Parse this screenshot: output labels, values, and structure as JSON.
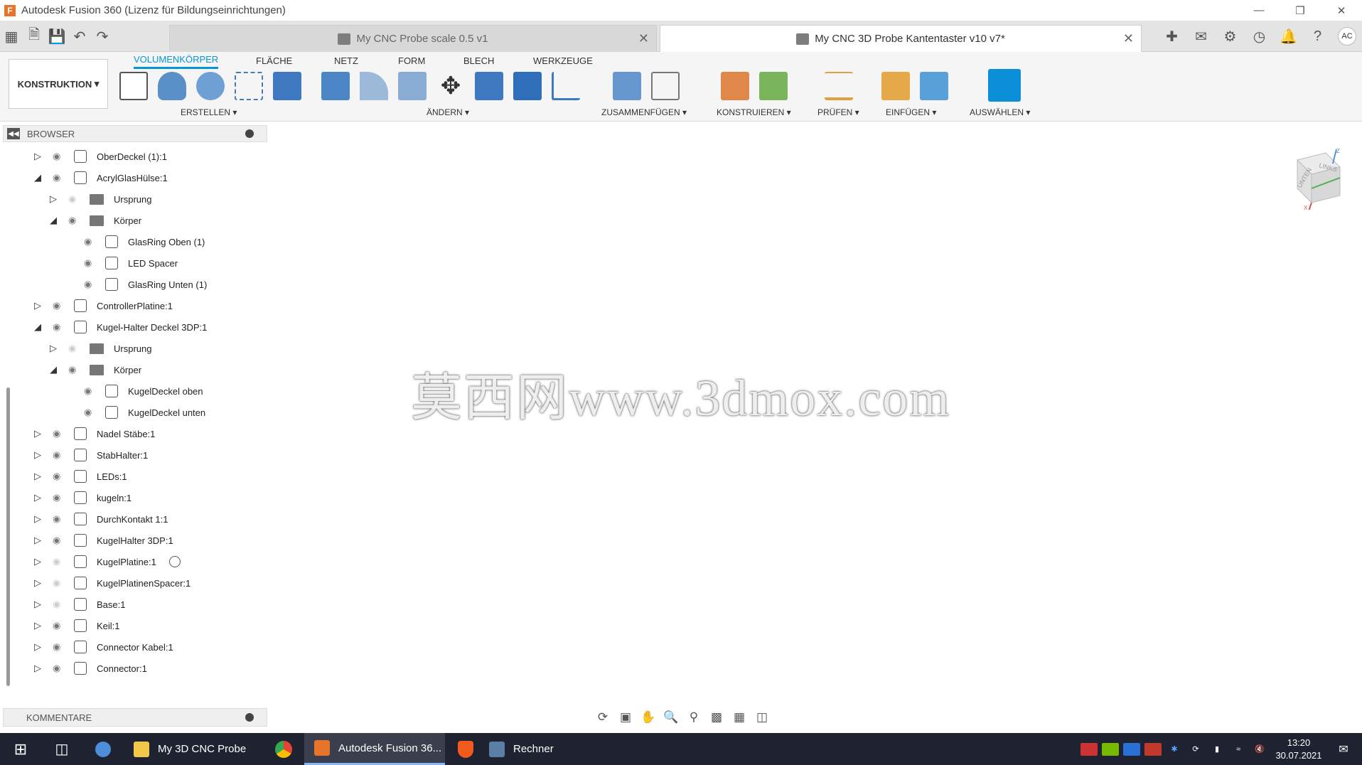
{
  "title": "Autodesk Fusion 360 (Lizenz für Bildungseinrichtungen)",
  "tabs": [
    {
      "label": "My CNC Probe scale 0.5 v1",
      "active": false
    },
    {
      "label": "My CNC 3D Probe Kantentaster v10 v7*",
      "active": true
    }
  ],
  "avatar": "AC",
  "workspace": "KONSTRUKTION",
  "ribbon_tabs": [
    "VOLUMENKÖRPER",
    "FLÄCHE",
    "NETZ",
    "FORM",
    "BLECH",
    "WERKZEUGE"
  ],
  "groups": {
    "erstellen": "ERSTELLEN",
    "aendern": "ÄNDERN",
    "zusammenfuegen": "ZUSAMMENFÜGEN",
    "konstruieren": "KONSTRUIEREN",
    "pruefen": "PRÜFEN",
    "einfuegen": "EINFÜGEN",
    "auswaehlen": "AUSWÄHLEN"
  },
  "browser_title": "BROWSER",
  "tree": [
    {
      "label": "OberDeckel (1):1",
      "level": 0,
      "expanded": false,
      "type": "comp",
      "visible": true
    },
    {
      "label": "AcrylGlasHülse:1",
      "level": 0,
      "expanded": true,
      "type": "comp",
      "visible": true
    },
    {
      "label": "Ursprung",
      "level": 1,
      "expanded": false,
      "type": "folder",
      "visible": false
    },
    {
      "label": "Körper",
      "level": 1,
      "expanded": true,
      "type": "folder",
      "visible": true
    },
    {
      "label": "GlasRing Oben (1)",
      "level": 2,
      "type": "body",
      "visible": true
    },
    {
      "label": "LED Spacer",
      "level": 2,
      "type": "body",
      "visible": true
    },
    {
      "label": "GlasRing Unten (1)",
      "level": 2,
      "type": "body",
      "visible": true
    },
    {
      "label": "ControllerPlatine:1",
      "level": 0,
      "expanded": false,
      "type": "comp",
      "visible": true
    },
    {
      "label": "Kugel-Halter Deckel 3DP:1",
      "level": 0,
      "expanded": true,
      "type": "comp",
      "visible": true
    },
    {
      "label": "Ursprung",
      "level": 1,
      "expanded": false,
      "type": "folder",
      "visible": false
    },
    {
      "label": "Körper",
      "level": 1,
      "expanded": true,
      "type": "folder",
      "visible": true
    },
    {
      "label": "KugelDeckel oben",
      "level": 2,
      "type": "body",
      "visible": true
    },
    {
      "label": "KugelDeckel unten",
      "level": 2,
      "type": "body",
      "visible": true
    },
    {
      "label": "Nadel Stäbe:1",
      "level": 0,
      "expanded": false,
      "type": "comp",
      "visible": true
    },
    {
      "label": "StabHalter:1",
      "level": 0,
      "expanded": false,
      "type": "comp",
      "visible": true
    },
    {
      "label": "LEDs:1",
      "level": 0,
      "expanded": false,
      "type": "comp",
      "visible": true
    },
    {
      "label": "kugeln:1",
      "level": 0,
      "expanded": false,
      "type": "comp",
      "visible": true
    },
    {
      "label": "DurchKontakt 1:1",
      "level": 0,
      "expanded": false,
      "type": "comp",
      "visible": true
    },
    {
      "label": "KugelHalter 3DP:1",
      "level": 0,
      "expanded": false,
      "type": "comp",
      "visible": true
    },
    {
      "label": "KugelPlatine:1",
      "level": 0,
      "expanded": false,
      "type": "comp",
      "visible": false,
      "radio": true
    },
    {
      "label": "KugelPlatinenSpacer:1",
      "level": 0,
      "expanded": false,
      "type": "comp",
      "visible": false
    },
    {
      "label": "Base:1",
      "level": 0,
      "expanded": false,
      "type": "comp",
      "visible": false
    },
    {
      "label": "Keil:1",
      "level": 0,
      "expanded": false,
      "type": "comp",
      "visible": true
    },
    {
      "label": "Connector Kabel:1",
      "level": 0,
      "expanded": false,
      "type": "comp",
      "visible": true
    },
    {
      "label": "Connector:1",
      "level": 0,
      "expanded": false,
      "type": "comp",
      "visible": true
    }
  ],
  "comments_title": "KOMMENTARE",
  "viewcube": {
    "top": "LINKS",
    "front": "UNTEN",
    "axis_x": "X",
    "axis_z": "Z"
  },
  "watermark": "莫西网www.3dmox.com",
  "taskbar": {
    "items": [
      {
        "label": "My 3D CNC Probe",
        "icon": "folder-icon"
      },
      {
        "label": "",
        "icon": "chrome-icon"
      },
      {
        "label": "Autodesk Fusion 36...",
        "icon": "fusion-icon",
        "active": true
      },
      {
        "label": "",
        "icon": "brave-icon"
      },
      {
        "label": "Rechner",
        "icon": "calculator-icon"
      }
    ],
    "time": "13:20",
    "date": "30.07.2021"
  },
  "colors": {
    "accent": "#0696d7",
    "red": "#a0302a",
    "yellow": "#d9a73a",
    "blue": "#3a6ea5",
    "rod": "#2e3568"
  }
}
